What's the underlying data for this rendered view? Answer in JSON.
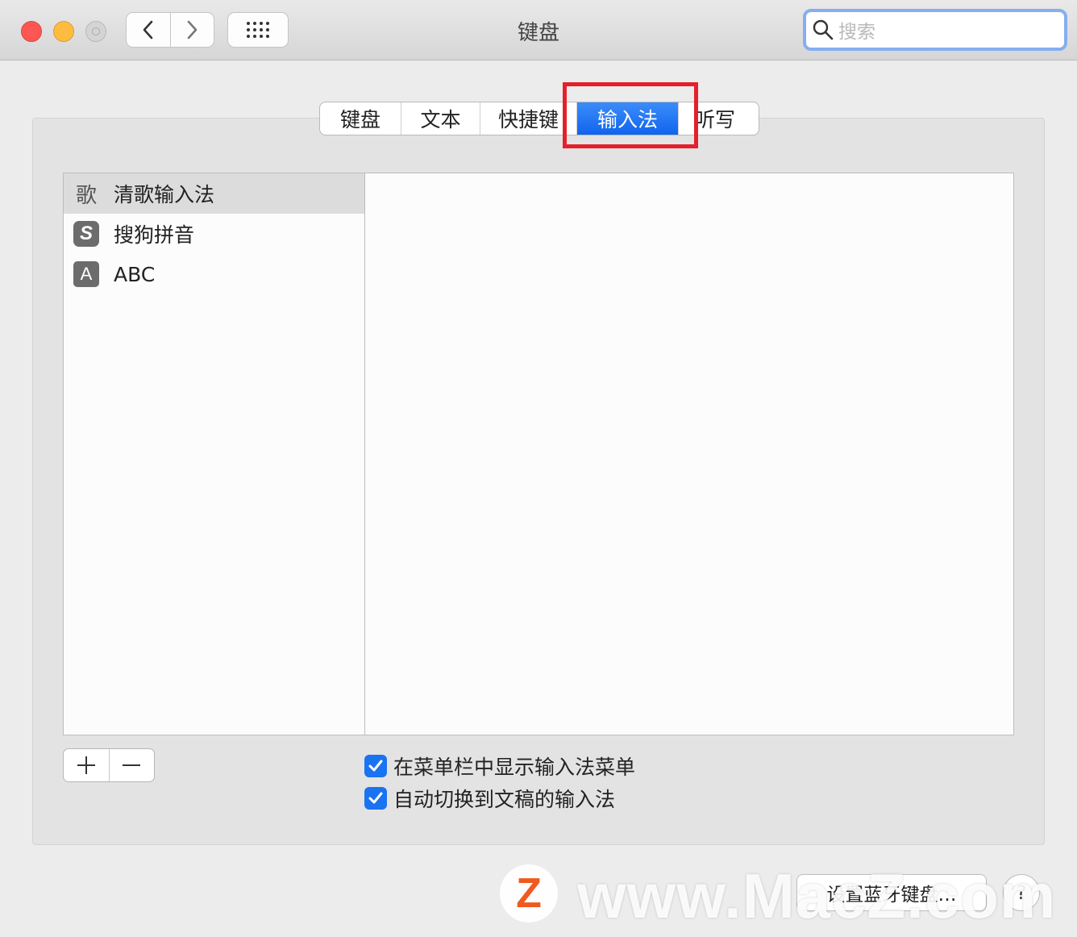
{
  "window": {
    "title": "键盘",
    "search_placeholder": "搜索"
  },
  "tabs": [
    {
      "label": "键盘",
      "active": false
    },
    {
      "label": "文本",
      "active": false
    },
    {
      "label": "快捷键",
      "active": false
    },
    {
      "label": "输入法",
      "active": true
    },
    {
      "label": "听写",
      "active": false
    }
  ],
  "input_sources": [
    {
      "name": "清歌输入法",
      "icon": "qingge-icon",
      "icon_glyph": "歌",
      "selected": true
    },
    {
      "name": "搜狗拼音",
      "icon": "sogou-icon",
      "icon_glyph": "S",
      "selected": false
    },
    {
      "name": "ABC",
      "icon": "abc-icon",
      "icon_glyph": "A",
      "selected": false
    }
  ],
  "options": [
    {
      "label": "在菜单栏中显示输入法菜单",
      "checked": true
    },
    {
      "label": "自动切换到文稿的输入法",
      "checked": true
    }
  ],
  "footer": {
    "bluetooth_button": "设置蓝牙键盘…",
    "help_label": "?"
  },
  "watermark": {
    "logo": "Z",
    "text": "www.MacZ.com"
  },
  "colors": {
    "accent": "#1a73f0",
    "highlight_box": "#e5202c",
    "close": "#fc5753",
    "minimize": "#fdbc40"
  }
}
